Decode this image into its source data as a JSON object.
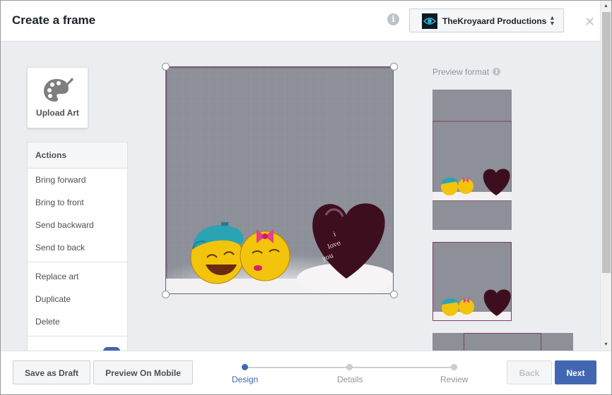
{
  "dialog": {
    "title": "Create a frame"
  },
  "page_selector": {
    "name": "TheKroyaard Productions",
    "caret": "⬍"
  },
  "upload": {
    "label": "Upload Art"
  },
  "actions": {
    "header": "Actions",
    "group1": [
      "Bring forward",
      "Bring to front",
      "Send backward",
      "Send to back"
    ],
    "group2": [
      "Replace art",
      "Duplicate",
      "Delete"
    ]
  },
  "canvas": {
    "artwork_text": "i love you"
  },
  "preview": {
    "label": "Preview format"
  },
  "footer": {
    "save_draft": "Save as Draft",
    "preview_mobile": "Preview On Mobile",
    "steps": [
      "Design",
      "Details",
      "Review"
    ],
    "active_step": "Design",
    "back": "Back",
    "next": "Next"
  },
  "colors": {
    "accent": "#4267b2",
    "frame_fill": "#8d8f99",
    "body_bg": "#ebedf0"
  }
}
